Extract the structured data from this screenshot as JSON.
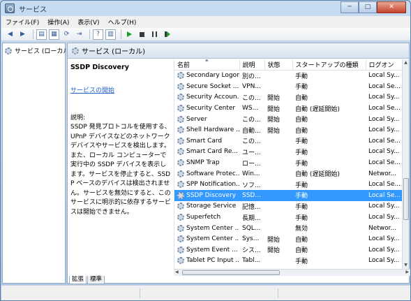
{
  "window": {
    "title": "サービス",
    "minimize_label": "─",
    "maximize_label": "□",
    "close_label": "✕"
  },
  "menu": [
    "ファイル(F)",
    "操作(A)",
    "表示(V)",
    "ヘルプ(H)"
  ],
  "toolbar_icons": [
    "back-arrow-icon",
    "forward-arrow-icon",
    "console-tree-icon",
    "properties-icon",
    "refresh-icon",
    "export-icon",
    "help-icon",
    "show-hide-icon",
    "start-service-icon",
    "stop-service-icon",
    "pause-service-icon",
    "restart-service-icon"
  ],
  "tree": {
    "item_label": "サービス (ローカル"
  },
  "main": {
    "header_title": "サービス (ローカル)",
    "detail": {
      "service_name": "SSDP Discovery",
      "start_link": "サービスの開始",
      "description_label": "説明:",
      "description": "SSDP 発見プロトコルを使用する、UPnP デバイスなどのネットワーク デバイスやサービスを検出します。また、ローカル コンピューターで実行中の SSDP デバイスを表示します。サービスを停止すると、SSDP ベースのデバイスは検出されません。サービスを無効にすると、このサービスに明示的に依存するサービスは開始できません。"
    },
    "columns": [
      "名前",
      "説明",
      "状態",
      "スタートアップの種類",
      "ログオン"
    ],
    "rows": [
      {
        "name": "Secondary Logon",
        "desc": "別の...",
        "status": "",
        "startup": "手動",
        "logon": "Local Sy..."
      },
      {
        "name": "Secure Socket ...",
        "desc": "VPN...",
        "status": "",
        "startup": "手動",
        "logon": "Local Se..."
      },
      {
        "name": "Security Accoun...",
        "desc": "この...",
        "status": "開始",
        "startup": "自動",
        "logon": "Local Sy..."
      },
      {
        "name": "Security Center",
        "desc": "WS...",
        "status": "開始",
        "startup": "自動 (遅延開始)",
        "logon": "Local Se..."
      },
      {
        "name": "Server",
        "desc": "この...",
        "status": "開始",
        "startup": "自動",
        "logon": "Local Sy..."
      },
      {
        "name": "Shell Hardware ...",
        "desc": "自動...",
        "status": "開始",
        "startup": "自動",
        "logon": "Local Sy..."
      },
      {
        "name": "Smart Card",
        "desc": "この...",
        "status": "",
        "startup": "手動",
        "logon": "Local Se..."
      },
      {
        "name": "Smart Card Re...",
        "desc": "ユー...",
        "status": "",
        "startup": "手動",
        "logon": "Local Sy..."
      },
      {
        "name": "SNMP Trap",
        "desc": "ロー...",
        "status": "",
        "startup": "手動",
        "logon": "Local Se..."
      },
      {
        "name": "Software Protec...",
        "desc": "Win...",
        "status": "",
        "startup": "自動 (遅延開始)",
        "logon": "Networ..."
      },
      {
        "name": "SPP Notification...",
        "desc": "ソフ...",
        "status": "",
        "startup": "手動",
        "logon": "Local Se..."
      },
      {
        "name": "SSDP Discovery",
        "desc": "SSD...",
        "status": "",
        "startup": "手動",
        "logon": "Local Se...",
        "selected": true
      },
      {
        "name": "Storage Service",
        "desc": "記憶...",
        "status": "",
        "startup": "手動",
        "logon": "Local Sy..."
      },
      {
        "name": "Superfetch",
        "desc": "長期...",
        "status": "",
        "startup": "手動",
        "logon": "Local Sy..."
      },
      {
        "name": "System Center ...",
        "desc": "SQL...",
        "status": "",
        "startup": "無効",
        "logon": "Networ..."
      },
      {
        "name": "System Center ...",
        "desc": "Sys...",
        "status": "開始",
        "startup": "自動",
        "logon": "Local Sy..."
      },
      {
        "name": "System Event ...",
        "desc": "シス...",
        "status": "開始",
        "startup": "自動",
        "logon": "Local Sy..."
      },
      {
        "name": "Tablet PC Input ...",
        "desc": "Tabl...",
        "status": "",
        "startup": "手動",
        "logon": "Local Sy..."
      }
    ],
    "tabs": [
      "拡張",
      "標準"
    ]
  }
}
